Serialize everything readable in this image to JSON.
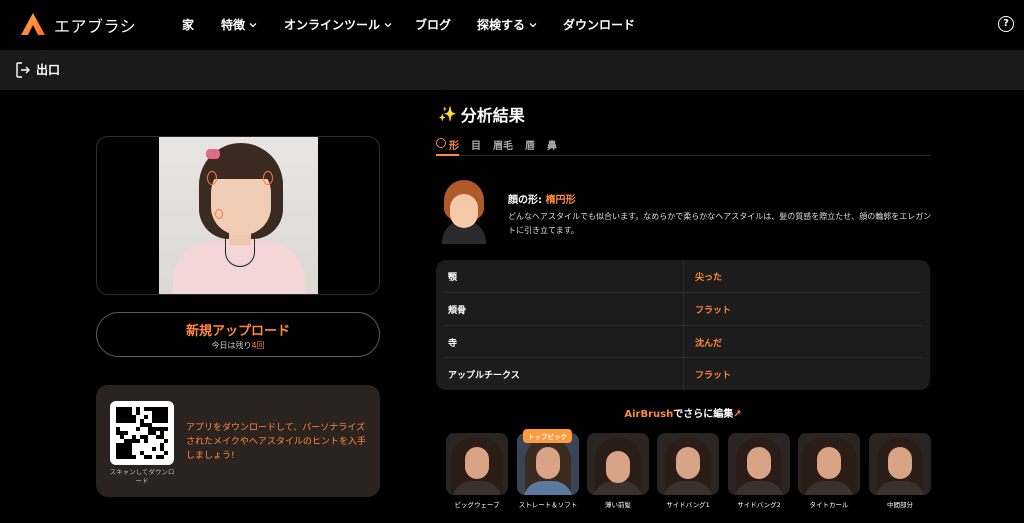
{
  "nav": {
    "brand": "エアブラシ",
    "items": [
      {
        "label": "家",
        "has_dropdown": false
      },
      {
        "label": "特徴",
        "has_dropdown": true
      },
      {
        "label": "オンラインツール",
        "has_dropdown": true
      },
      {
        "label": "ブログ",
        "has_dropdown": false
      },
      {
        "label": "探検する",
        "has_dropdown": true
      },
      {
        "label": "ダウンロード",
        "has_dropdown": false
      }
    ],
    "help_icon": "?"
  },
  "subbar": {
    "exit_label": "出口"
  },
  "upload": {
    "title": "新規アップロード",
    "remaining_prefix": "今日は残り",
    "remaining_count": "4回"
  },
  "promo": {
    "qr_caption": "スキャンしてダウンロード",
    "text": "アプリをダウンロードして、パーソナライズされたメイクやヘアスタイルのヒントを入手しましょう!"
  },
  "result": {
    "title": "分析結果",
    "tabs": [
      "形",
      "目",
      "眉毛",
      "唇",
      "鼻"
    ],
    "active_tab": 0,
    "shape_label": "顔の形:",
    "shape_value": "楕円形",
    "shape_desc": "どんなヘアスタイルでも似合います。なめらかで柔らかなヘアスタイルは、髪の質感を際立たせ、顔の輪郭をエレガントに引き立てます。",
    "features": [
      {
        "name": "顎",
        "value": "尖った"
      },
      {
        "name": "頬骨",
        "value": "フラット"
      },
      {
        "name": "寺",
        "value": "沈んだ"
      },
      {
        "name": "アップルチークス",
        "value": "フラット"
      }
    ]
  },
  "edit": {
    "brand": "AirBrush",
    "text": "でさらに編集",
    "arrow": "↗"
  },
  "styles": {
    "top_pick_label": "トップピック",
    "items": [
      {
        "label": "ビッグウェーブ"
      },
      {
        "label": "ストレート＆ソフト"
      },
      {
        "label": "薄い前髪"
      },
      {
        "label": "サイドバング1"
      },
      {
        "label": "サイドバング2"
      },
      {
        "label": "タイトカール"
      },
      {
        "label": "中間部分"
      }
    ]
  },
  "colors": {
    "accent": "#ff8a3d",
    "background": "#000000",
    "panel": "#1c1c1c"
  }
}
